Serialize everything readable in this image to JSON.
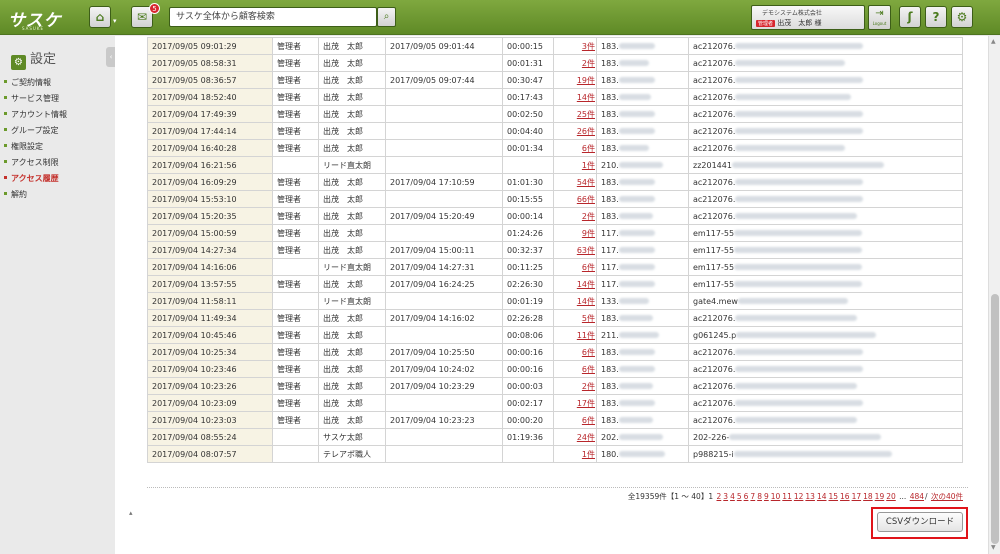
{
  "header": {
    "logo": "サスケ",
    "logo_sub": "SASUKE",
    "home_icon": "home-icon",
    "message_badge": "5",
    "search_placeholder": "サスケ全体から顧客検索",
    "company": "デモシステム株式会社",
    "admin_tag": "管理者",
    "user_name": "出茂　太郎 様",
    "logout_label": "Logout",
    "help_label": "?"
  },
  "sidebar": {
    "title": "設定",
    "items": [
      {
        "label": "ご契約情報",
        "active": false
      },
      {
        "label": "サービス管理",
        "active": false
      },
      {
        "label": "アカウント情報",
        "active": false
      },
      {
        "label": "グループ設定",
        "active": false
      },
      {
        "label": "権限設定",
        "active": false
      },
      {
        "label": "アクセス制限",
        "active": false
      },
      {
        "label": "アクセス履歴",
        "active": true
      },
      {
        "label": "解約",
        "active": false
      }
    ]
  },
  "rows": [
    {
      "login": "2017/09/05 09:01:29",
      "role": "管理者",
      "name": "出茂　太郎",
      "logout": "2017/09/05 09:01:44",
      "duration": "00:00:15",
      "count": "3件",
      "ip": "183.",
      "host": "ac212076."
    },
    {
      "login": "2017/09/05 08:58:31",
      "role": "管理者",
      "name": "出茂　太郎",
      "logout": "",
      "duration": "00:01:31",
      "count": "2件",
      "ip": "183.",
      "host": "ac212076."
    },
    {
      "login": "2017/09/05 08:36:57",
      "role": "管理者",
      "name": "出茂　太郎",
      "logout": "2017/09/05 09:07:44",
      "duration": "00:30:47",
      "count": "19件",
      "ip": "183.",
      "host": "ac212076."
    },
    {
      "login": "2017/09/04 18:52:40",
      "role": "管理者",
      "name": "出茂　太郎",
      "logout": "",
      "duration": "00:17:43",
      "count": "14件",
      "ip": "183.",
      "host": "ac212076."
    },
    {
      "login": "2017/09/04 17:49:39",
      "role": "管理者",
      "name": "出茂　太郎",
      "logout": "",
      "duration": "00:02:50",
      "count": "25件",
      "ip": "183.",
      "host": "ac212076."
    },
    {
      "login": "2017/09/04 17:44:14",
      "role": "管理者",
      "name": "出茂　太郎",
      "logout": "",
      "duration": "00:04:40",
      "count": "26件",
      "ip": "183.",
      "host": "ac212076."
    },
    {
      "login": "2017/09/04 16:40:28",
      "role": "管理者",
      "name": "出茂　太郎",
      "logout": "",
      "duration": "00:01:34",
      "count": "6件",
      "ip": "183.",
      "host": "ac212076."
    },
    {
      "login": "2017/09/04 16:21:56",
      "role": "",
      "name": "リード直太朗",
      "logout": "",
      "duration": "",
      "count": "1件",
      "ip": "210.",
      "host": "zz201441"
    },
    {
      "login": "2017/09/04 16:09:29",
      "role": "管理者",
      "name": "出茂　太郎",
      "logout": "2017/09/04 17:10:59",
      "duration": "01:01:30",
      "count": "54件",
      "ip": "183.",
      "host": "ac212076."
    },
    {
      "login": "2017/09/04 15:53:10",
      "role": "管理者",
      "name": "出茂　太郎",
      "logout": "",
      "duration": "00:15:55",
      "count": "66件",
      "ip": "183.",
      "host": "ac212076."
    },
    {
      "login": "2017/09/04 15:20:35",
      "role": "管理者",
      "name": "出茂　太郎",
      "logout": "2017/09/04 15:20:49",
      "duration": "00:00:14",
      "count": "2件",
      "ip": "183.",
      "host": "ac212076."
    },
    {
      "login": "2017/09/04 15:00:59",
      "role": "管理者",
      "name": "出茂　太郎",
      "logout": "",
      "duration": "01:24:26",
      "count": "9件",
      "ip": "117.",
      "host": "em117-55"
    },
    {
      "login": "2017/09/04 14:27:34",
      "role": "管理者",
      "name": "出茂　太郎",
      "logout": "2017/09/04 15:00:11",
      "duration": "00:32:37",
      "count": "63件",
      "ip": "117.",
      "host": "em117-55"
    },
    {
      "login": "2017/09/04 14:16:06",
      "role": "",
      "name": "リード直太朗",
      "logout": "2017/09/04 14:27:31",
      "duration": "00:11:25",
      "count": "6件",
      "ip": "117.",
      "host": "em117-55"
    },
    {
      "login": "2017/09/04 13:57:55",
      "role": "管理者",
      "name": "出茂　太郎",
      "logout": "2017/09/04 16:24:25",
      "duration": "02:26:30",
      "count": "14件",
      "ip": "117.",
      "host": "em117-55"
    },
    {
      "login": "2017/09/04 11:58:11",
      "role": "",
      "name": "リード直太朗",
      "logout": "",
      "duration": "00:01:19",
      "count": "14件",
      "ip": "133.",
      "host": "gate4.mew"
    },
    {
      "login": "2017/09/04 11:49:34",
      "role": "管理者",
      "name": "出茂　太郎",
      "logout": "2017/09/04 14:16:02",
      "duration": "02:26:28",
      "count": "5件",
      "ip": "183.",
      "host": "ac212076."
    },
    {
      "login": "2017/09/04 10:45:46",
      "role": "管理者",
      "name": "出茂　太郎",
      "logout": "",
      "duration": "00:08:06",
      "count": "11件",
      "ip": "211.",
      "host": "g061245.p"
    },
    {
      "login": "2017/09/04 10:25:34",
      "role": "管理者",
      "name": "出茂　太郎",
      "logout": "2017/09/04 10:25:50",
      "duration": "00:00:16",
      "count": "6件",
      "ip": "183.",
      "host": "ac212076."
    },
    {
      "login": "2017/09/04 10:23:46",
      "role": "管理者",
      "name": "出茂　太郎",
      "logout": "2017/09/04 10:24:02",
      "duration": "00:00:16",
      "count": "6件",
      "ip": "183.",
      "host": "ac212076."
    },
    {
      "login": "2017/09/04 10:23:26",
      "role": "管理者",
      "name": "出茂　太郎",
      "logout": "2017/09/04 10:23:29",
      "duration": "00:00:03",
      "count": "2件",
      "ip": "183.",
      "host": "ac212076."
    },
    {
      "login": "2017/09/04 10:23:09",
      "role": "管理者",
      "name": "出茂　太郎",
      "logout": "",
      "duration": "00:02:17",
      "count": "17件",
      "ip": "183.",
      "host": "ac212076."
    },
    {
      "login": "2017/09/04 10:23:03",
      "role": "管理者",
      "name": "出茂　太郎",
      "logout": "2017/09/04 10:23:23",
      "duration": "00:00:20",
      "count": "6件",
      "ip": "183.",
      "host": "ac212076."
    },
    {
      "login": "2017/09/04 08:55:24",
      "role": "",
      "name": "サスケ太郎",
      "logout": "",
      "duration": "01:19:36",
      "count": "24件",
      "ip": "202.",
      "host": "202-226-"
    },
    {
      "login": "2017/09/04 08:07:57",
      "role": "",
      "name": "テレアポ職人",
      "logout": "",
      "duration": "",
      "count": "1件",
      "ip": "180.",
      "host": "p988215-i"
    }
  ],
  "pager": {
    "summary": "全19359件【1 ～ 40】1",
    "pages": [
      "2",
      "3",
      "4",
      "5",
      "6",
      "7",
      "8",
      "9",
      "10",
      "11",
      "12",
      "13",
      "14",
      "15",
      "16",
      "17",
      "18",
      "19",
      "20"
    ],
    "ellipsis": "...",
    "last": "484",
    "separator": "/",
    "next": "次の40件"
  },
  "footer_mark": "▴",
  "csv_button": "CSVダウンロード",
  "colors": {
    "header_green": "#6b9a2b",
    "link_red": "#b8262b",
    "highlight_red": "#e0141a"
  }
}
